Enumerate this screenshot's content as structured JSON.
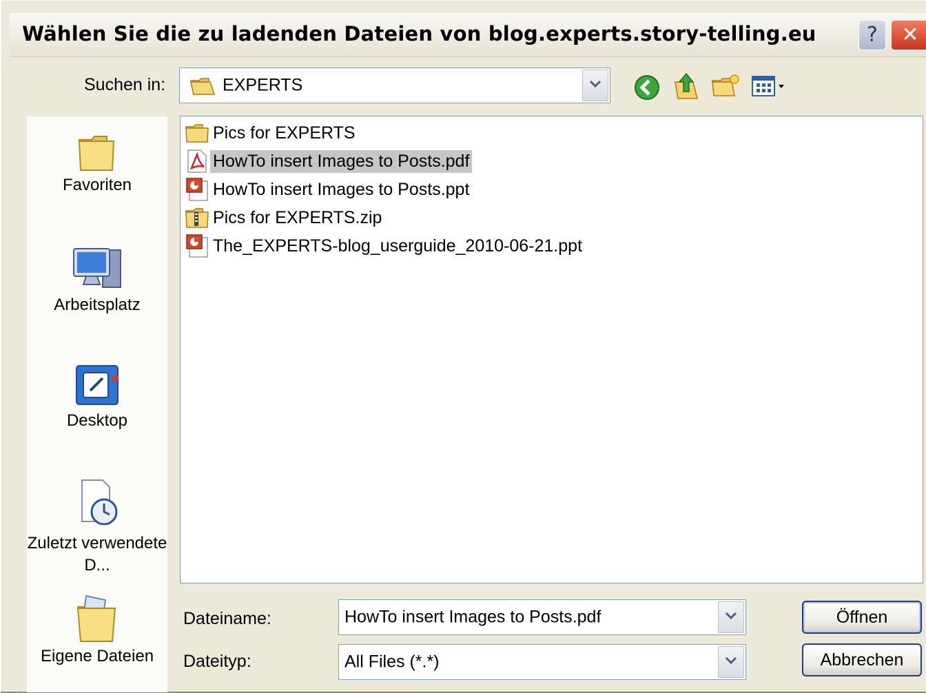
{
  "dialog": {
    "title": "Wählen Sie die zu ladenden Dateien von blog.experts.story-telling.eu",
    "help_label": "?",
    "close_label": "✕"
  },
  "lookin": {
    "label": "Suchen in:",
    "value": "EXPERTS",
    "toolbar_icons": [
      "back-icon",
      "up-folder-icon",
      "new-folder-icon",
      "view-menu-icon"
    ]
  },
  "places": [
    {
      "label": "Favoriten",
      "icon": "favorites-folder-icon"
    },
    {
      "label": "Arbeitsplatz",
      "icon": "my-computer-icon"
    },
    {
      "label": "Desktop",
      "icon": "desktop-icon"
    },
    {
      "label": "Zuletzt verwendete D...",
      "icon": "recent-documents-icon"
    },
    {
      "label": "Eigene Dateien",
      "icon": "my-documents-icon"
    }
  ],
  "files": [
    {
      "name": "Pics for EXPERTS",
      "icon": "folder-icon",
      "selected": false
    },
    {
      "name": "HowTo insert Images to Posts.pdf",
      "icon": "pdf-icon",
      "selected": true
    },
    {
      "name": "HowTo insert Images to Posts.ppt",
      "icon": "ppt-icon",
      "selected": false
    },
    {
      "name": "Pics for EXPERTS.zip",
      "icon": "zip-icon",
      "selected": false
    },
    {
      "name": "The_EXPERTS-blog_userguide_2010-06-21.ppt",
      "icon": "ppt-icon",
      "selected": false
    }
  ],
  "filename": {
    "label": "Dateiname:",
    "value": "HowTo insert Images to Posts.pdf"
  },
  "filetype": {
    "label": "Dateityp:",
    "value": "All Files (*.*)"
  },
  "buttons": {
    "open": "Öffnen",
    "cancel": "Abbrechen"
  }
}
